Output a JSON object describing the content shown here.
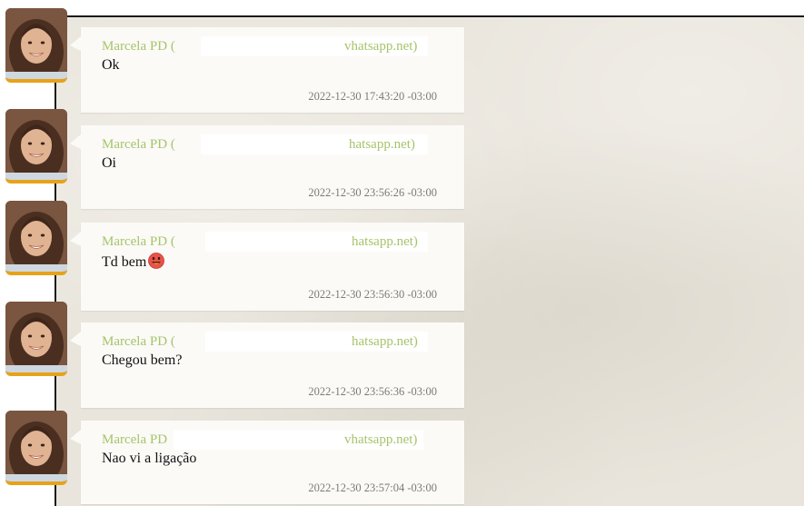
{
  "messages": [
    {
      "sender_name": "Marcela PD",
      "sender_open": "(",
      "sender_tail": "vhatsapp.net)",
      "text": "Ok",
      "timestamp": "2022-12-30 17:43:20 -03:00",
      "emoji": ""
    },
    {
      "sender_name": "Marcela PD",
      "sender_open": "(",
      "sender_tail": "hatsapp.net)",
      "text": "Oi",
      "timestamp": "2022-12-30 23:56:26 -03:00",
      "emoji": ""
    },
    {
      "sender_name": "Marcela PD",
      "sender_open": "(",
      "sender_tail": "hatsapp.net)",
      "text": "Td bem",
      "timestamp": "2022-12-30 23:56:30 -03:00",
      "emoji": "grinning-face-emoji"
    },
    {
      "sender_name": "Marcela PD",
      "sender_open": "(",
      "sender_tail": "hatsapp.net)",
      "text": "Chegou bem?",
      "timestamp": "2022-12-30 23:56:36 -03:00",
      "emoji": ""
    },
    {
      "sender_name": "Marcela PD",
      "sender_open": "",
      "sender_tail": "vhatsapp.net)",
      "text": "Nao vi a ligação",
      "timestamp": "2022-12-30 23:57:04 -03:00",
      "emoji": ""
    }
  ],
  "colors": {
    "sender": "#a6c46a",
    "bubble": "#fbfaf7",
    "avatar_border": "#e8a219",
    "pane_background": "#e9e5dc"
  },
  "icons": {
    "avatar": "contact-photo-avatar"
  }
}
